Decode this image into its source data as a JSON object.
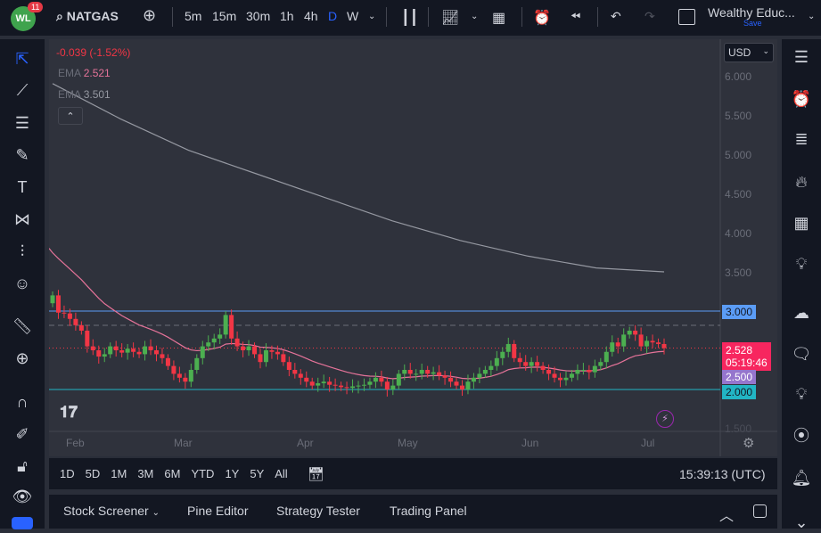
{
  "header": {
    "logo": "WL",
    "notifications": "11",
    "symbol": "NATGAS",
    "intervals": [
      "5m",
      "15m",
      "30m",
      "1h",
      "4h",
      "D",
      "W"
    ],
    "active_interval": "D",
    "layout_name": "Wealthy Educ...",
    "save_label": "Save"
  },
  "legend": {
    "change": "-0.039 (-1.52%)",
    "ema_label": "EMA",
    "ema1": "2.521",
    "ema2": "3.501"
  },
  "currency": "USD",
  "price_labels": [
    "6.000",
    "5.500",
    "5.000",
    "4.500",
    "4.000",
    "3.500",
    "1.500"
  ],
  "tags": {
    "level_high": "3.000",
    "last_price": "2.528",
    "countdown": "05:19:46",
    "level_mid": "2.500",
    "level_low": "2.000"
  },
  "time_labels": [
    "Feb",
    "Mar",
    "Apr",
    "May",
    "Jun",
    "Jul"
  ],
  "ranges": [
    "1D",
    "5D",
    "1M",
    "3M",
    "6M",
    "YTD",
    "1Y",
    "5Y",
    "All"
  ],
  "clock": "15:39:13 (UTC)",
  "bottom_tabs": [
    "Stock Screener",
    "Pine Editor",
    "Strategy Tester",
    "Trading Panel"
  ],
  "colors": {
    "up": "#4caf50",
    "down": "#f23645",
    "ema20": "#e57399",
    "ema200": "#9598a1",
    "level": "#5b9cf6",
    "support": "#22b5c4"
  },
  "chart_data": {
    "type": "candlestick",
    "symbol": "NATGAS",
    "ylim": [
      1.5,
      6.2
    ],
    "closes": [
      3.2,
      2.98,
      2.97,
      2.9,
      2.82,
      2.75,
      2.55,
      2.5,
      2.42,
      2.45,
      2.55,
      2.5,
      2.47,
      2.52,
      2.48,
      2.45,
      2.55,
      2.5,
      2.45,
      2.4,
      2.3,
      2.2,
      2.15,
      2.1,
      2.25,
      2.4,
      2.55,
      2.6,
      2.65,
      2.7,
      2.95,
      2.65,
      2.55,
      2.5,
      2.55,
      2.45,
      2.35,
      2.5,
      2.48,
      2.45,
      2.35,
      2.25,
      2.2,
      2.15,
      2.1,
      2.05,
      2.08,
      2.1,
      2.06,
      2.05,
      2.03,
      2.02,
      2.04,
      2.05,
      2.06,
      2.1,
      2.15,
      2.1,
      2.0,
      2.05,
      2.2,
      2.25,
      2.2,
      2.2,
      2.25,
      2.2,
      2.22,
      2.18,
      2.15,
      2.1,
      2.05,
      2.0,
      2.1,
      2.15,
      2.2,
      2.25,
      2.3,
      2.4,
      2.48,
      2.58,
      2.4,
      2.35,
      2.3,
      2.35,
      2.3,
      2.25,
      2.2,
      2.15,
      2.12,
      2.15,
      2.2,
      2.25,
      2.25,
      2.22,
      2.3,
      2.35,
      2.48,
      2.6,
      2.55,
      2.7,
      2.75,
      2.7,
      2.55,
      2.62,
      2.6,
      2.58,
      2.528
    ],
    "ema200": [
      5.9,
      5.45,
      5.05,
      4.75,
      4.45,
      4.15,
      3.9,
      3.7,
      3.55,
      3.5
    ],
    "levels": [
      3.0,
      2.5,
      2.0
    ]
  }
}
